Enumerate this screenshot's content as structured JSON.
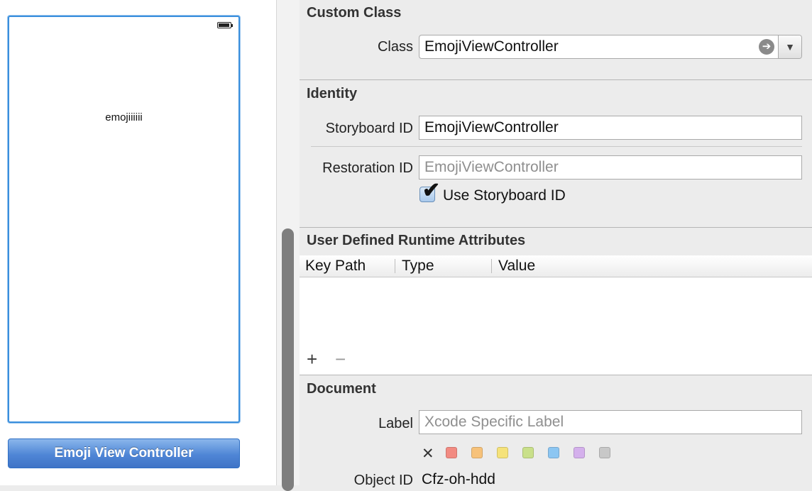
{
  "canvas": {
    "view_label": "emojiiiiii",
    "scene_button_label": "Emoji View Controller"
  },
  "inspector": {
    "custom_class": {
      "title": "Custom Class",
      "class_label": "Class",
      "class_value": "EmojiViewController"
    },
    "identity": {
      "title": "Identity",
      "storyboard_id_label": "Storyboard ID",
      "storyboard_id_value": "EmojiViewController",
      "restoration_id_label": "Restoration ID",
      "restoration_id_placeholder": "EmojiViewController",
      "use_storyboard_id_label": "Use Storyboard ID",
      "use_storyboard_id_checked": true
    },
    "runtime_attributes": {
      "title": "User Defined Runtime Attributes",
      "columns": [
        "Key Path",
        "Type",
        "Value"
      ],
      "rows": [],
      "add_label": "+",
      "remove_label": "−"
    },
    "document": {
      "title": "Document",
      "label_label": "Label",
      "label_placeholder": "Xcode Specific Label",
      "clear_color_label": "✕",
      "label_colors": [
        "#f28b82",
        "#f7c27a",
        "#f5e27a",
        "#c9e08a",
        "#8cc6f2",
        "#d4b0ec",
        "#c8c8c8"
      ],
      "object_id_label": "Object ID",
      "object_id_value": "Cfz-oh-hdd"
    }
  },
  "colors": {
    "selection_blue": "#3a8fdd",
    "scene_button_blue": "#4f86d6",
    "inspector_background": "#ececec"
  }
}
